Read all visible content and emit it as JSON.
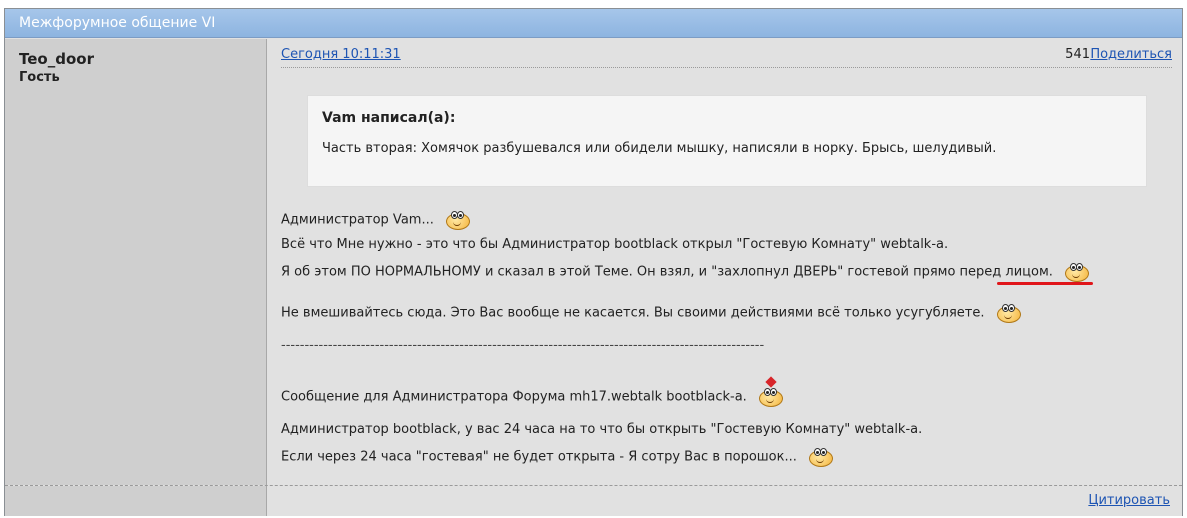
{
  "forum": {
    "title": "Межфорумное общение VI"
  },
  "author": {
    "name": "Teo_door",
    "role": "Гость"
  },
  "post": {
    "date": "Сегодня 10:11:31",
    "number": "541",
    "share_label": "Поделиться",
    "quote": {
      "title": "Vam написал(а):",
      "text": "Часть вторая: Хомячок разбушевался или обидели мышку, написяли в норку. Брысь, шелудивый."
    },
    "lines": {
      "l1": "Администратор Vam...",
      "l2": "Всё что Мне нужно - это что бы Администратор bootblack открыл \"Гостевую Комнату\" webtalk-а.",
      "l3": "Я об этом ПО НОРМАЛЬНОМУ и сказал в этой Теме. Он взял, и \"захлопнул ДВЕРЬ\" гостевой прямо перед лицом.",
      "l4": "Не вмешивайтесь сюда. Это Вас вообще не касается. Вы своими действиями всё только усугубляете.",
      "separator": "-------------------------------------------------------------------------------------------------------",
      "l5": "Сообщение для Администратора Форума mh17.webtalk bootblack-а.",
      "l6": "Администратор bootblack, у вас 24 часа на то что бы открыть \"Гостевую Комнату\" webtalk-а.",
      "l7": "Если через 24 часа \"гостевая\" не будет открыта - Я сотру Вас в порошок..."
    },
    "cite_label": "Цитировать"
  },
  "icons": {
    "smiley": "smiley-icon",
    "smiley_hat": "smiley-hat-icon"
  },
  "colors": {
    "titlebar": "#8db4e0",
    "link": "#1d54b3",
    "annotation": "#e0151a"
  }
}
